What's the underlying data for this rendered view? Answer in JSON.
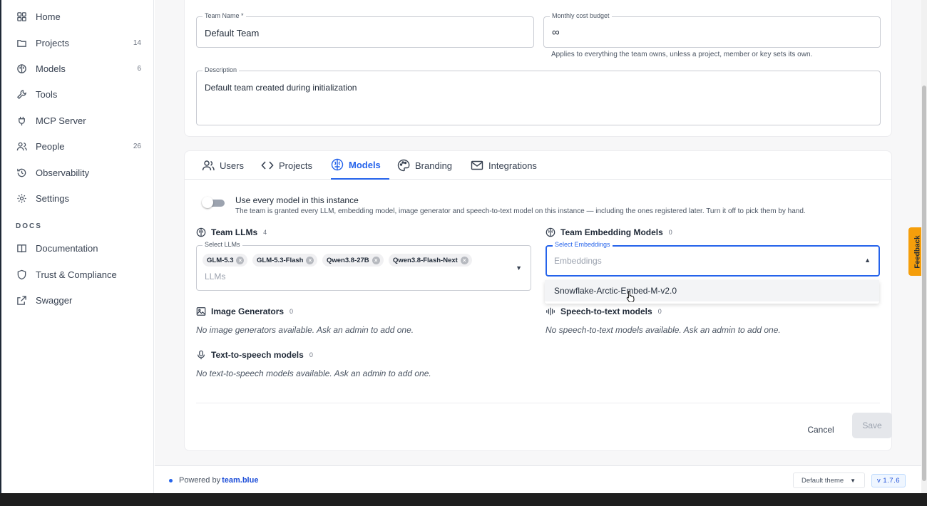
{
  "sidebar": {
    "items": [
      {
        "label": "Home",
        "count": "",
        "icon": "grid-icon"
      },
      {
        "label": "Projects",
        "count": "14",
        "icon": "folder-icon"
      },
      {
        "label": "Models",
        "count": "6",
        "icon": "brain-icon"
      },
      {
        "label": "Tools",
        "count": "",
        "icon": "wrench-icon"
      },
      {
        "label": "MCP Server",
        "count": "",
        "icon": "plug-icon"
      },
      {
        "label": "People",
        "count": "26",
        "icon": "users-icon"
      },
      {
        "label": "Observability",
        "count": "",
        "icon": "history-icon"
      },
      {
        "label": "Settings",
        "count": "",
        "icon": "gear-icon"
      }
    ],
    "docs_heading": "DOCS",
    "docs": [
      {
        "label": "Documentation",
        "icon": "book-icon"
      },
      {
        "label": "Trust & Compliance",
        "icon": "shield-icon"
      },
      {
        "label": "Swagger",
        "icon": "external-link-icon"
      }
    ]
  },
  "team_form": {
    "name_label": "Team Name *",
    "name_value": "Default Team",
    "budget_label": "Monthly cost budget",
    "budget_value": "∞",
    "budget_helper": "Applies to everything the team owns, unless a project, member or key sets its own.",
    "description_label": "Description",
    "description_value": "Default team created during initialization"
  },
  "tabs": [
    {
      "label": "Users",
      "icon": "users-icon",
      "active": false
    },
    {
      "label": "Projects",
      "icon": "code-icon",
      "active": false
    },
    {
      "label": "Models",
      "icon": "brain-icon",
      "active": true
    },
    {
      "label": "Branding",
      "icon": "palette-icon",
      "active": false
    },
    {
      "label": "Integrations",
      "icon": "mail-icon",
      "active": false
    }
  ],
  "models_tab": {
    "toggle_title": "Use every model in this instance",
    "toggle_desc": "The team is granted every LLM, embedding model, image generator and speech-to-text model on this instance — including the ones registered later. Turn it off to pick them by hand.",
    "toggle_on": false,
    "llms": {
      "title": "Team LLMs",
      "count": "4",
      "select_label": "Select LLMs",
      "placeholder": "LLMs",
      "selected": [
        "GLM-5.3",
        "GLM-5.3-Flash",
        "Qwen3.8-27B",
        "Qwen3.8-Flash-Next"
      ]
    },
    "embeddings": {
      "title": "Team Embedding Models",
      "count": "0",
      "select_label": "Select Embeddings",
      "placeholder": "Embeddings",
      "options": [
        "Snowflake-Arctic-Embed-M-v2.0"
      ]
    },
    "image_generators": {
      "title": "Image Generators",
      "count": "0",
      "empty": "No image generators available. Ask an admin to add one."
    },
    "speech_to_text": {
      "title": "Speech-to-text models",
      "count": "0",
      "empty": "No speech-to-text models available. Ask an admin to add one."
    },
    "text_to_speech": {
      "title": "Text-to-speech models",
      "count": "0",
      "empty": "No text-to-speech models available. Ask an admin to add one."
    },
    "cancel_label": "Cancel",
    "save_label": "Save"
  },
  "footer": {
    "powered_prefix": "Powered by",
    "brand": "team.blue",
    "theme": "Default theme",
    "version": "v 1.7.6"
  },
  "feedback_label": "Feedback",
  "colors": {
    "accent": "#2563eb",
    "feedback": "#f59e0b"
  }
}
